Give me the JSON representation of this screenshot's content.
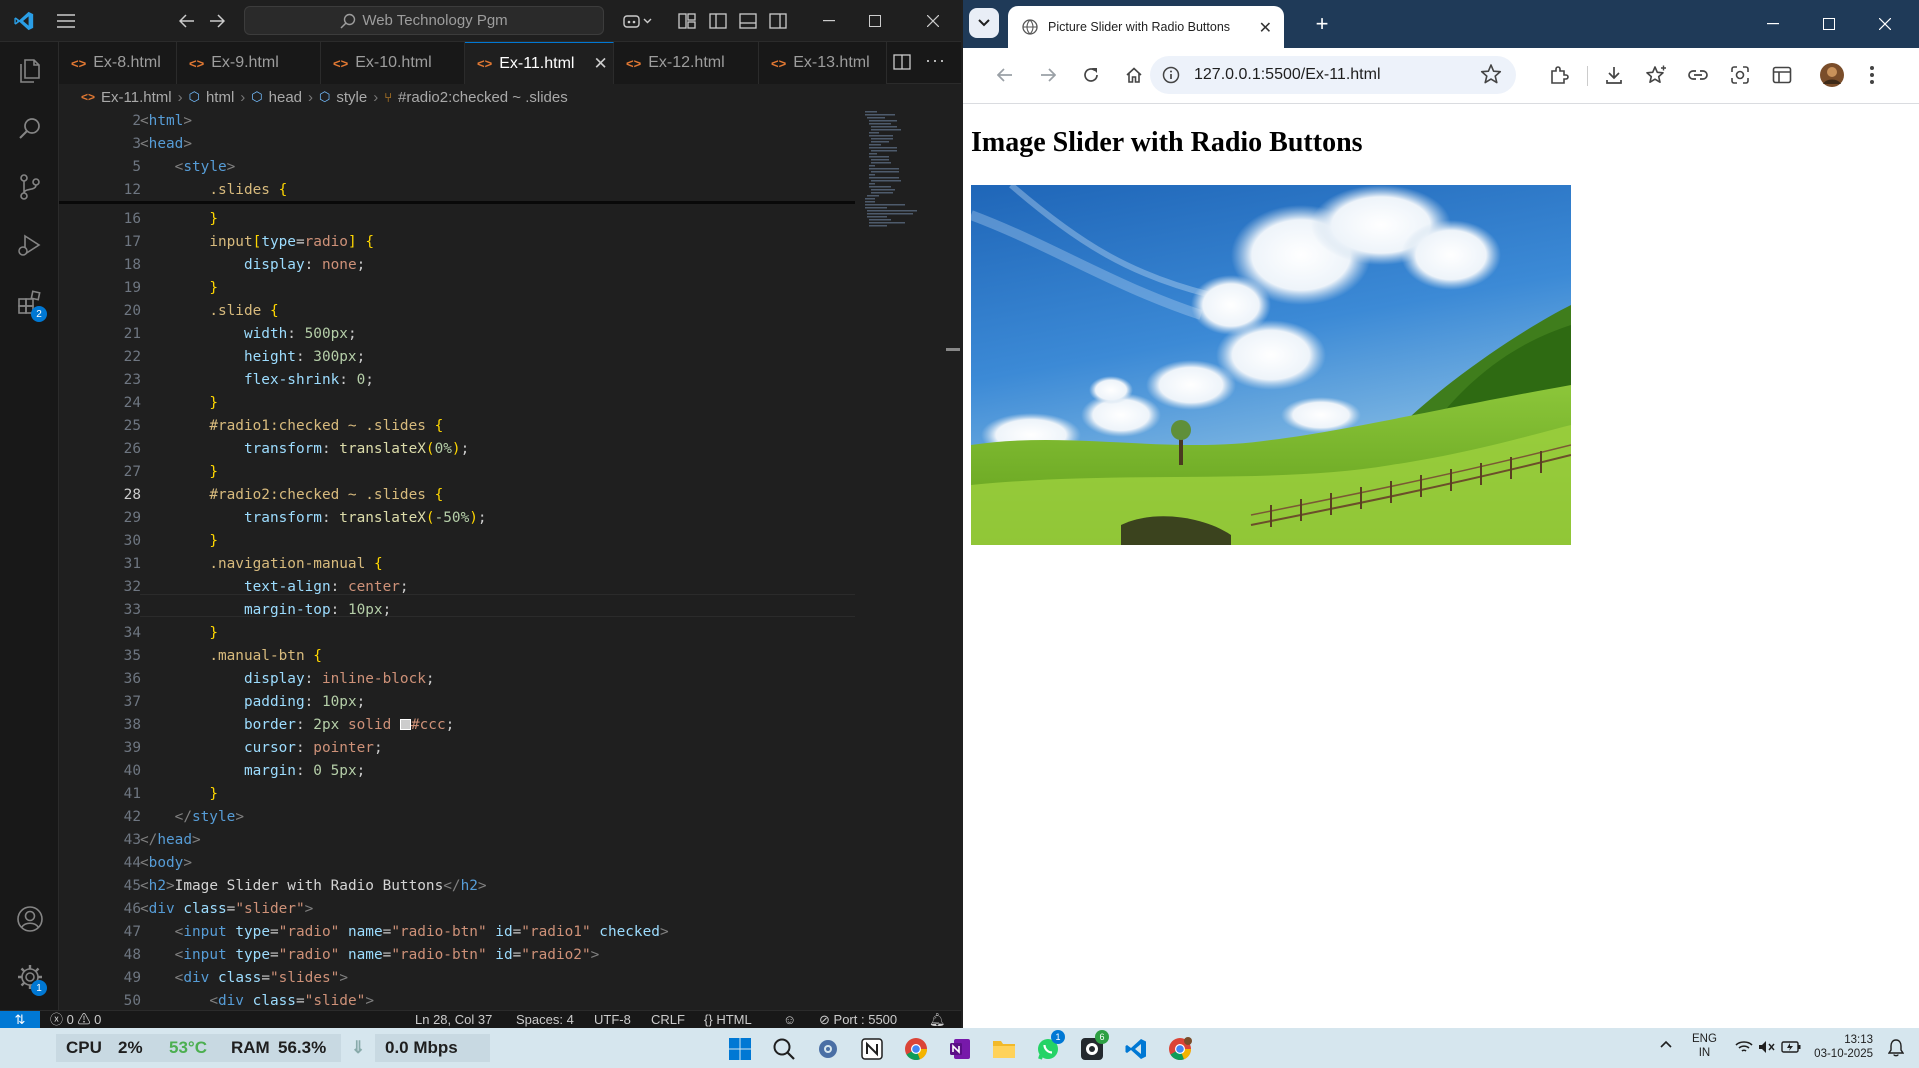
{
  "vscode": {
    "search_text": "Web Technology Pgm",
    "tabs": [
      {
        "label": "Ex-8.html"
      },
      {
        "label": "Ex-9.html"
      },
      {
        "label": "Ex-10.html"
      },
      {
        "label": "Ex-11.html",
        "active": true
      },
      {
        "label": "Ex-12.html"
      },
      {
        "label": "Ex-13.html"
      }
    ],
    "breadcrumb": [
      "Ex-11.html",
      "html",
      "head",
      "style",
      "#radio2:checked ~ .slides"
    ],
    "activity_badges": {
      "extensions": "2",
      "settings": "1"
    },
    "status": {
      "errors": "0",
      "warnings": "0",
      "position": "Ln 28, Col 37",
      "spaces": "Spaces: 4",
      "encoding": "UTF-8",
      "eol": "CRLF",
      "language": "HTML",
      "port": "Port : 5500"
    }
  },
  "browser": {
    "tab_title": "Picture Slider with Radio Buttons",
    "url": "127.0.0.1:5500/Ex-11.html",
    "page_heading": "Image Slider with Radio Buttons"
  },
  "taskbar": {
    "cpu_label": "CPU",
    "cpu_value": "2%",
    "temp": "53°C",
    "ram_label": "RAM",
    "ram_value": "56.3%",
    "net": "0.0 Mbps",
    "lang_top": "ENG",
    "lang_bottom": "IN",
    "time": "13:13",
    "date": "03-10-2025",
    "whatsapp_badge": "1",
    "github_badge": "6"
  },
  "colors": {
    "vscode_bg": "#1f1f1f",
    "accent": "#0078d4",
    "chrome_frame": "#1f3a58",
    "taskbar": "#d6e6ee"
  }
}
